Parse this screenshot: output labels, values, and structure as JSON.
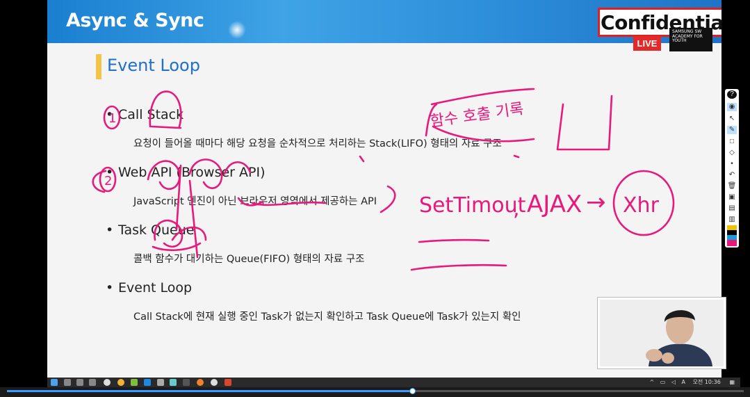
{
  "slide": {
    "header_title": "Async & Sync",
    "confidential": "Confidential",
    "live": "LIVE",
    "academy_logo": "SAMSUNG SW ACADEMY FOR YOUTH",
    "section_title": "Event Loop",
    "items": [
      {
        "bullet": "•",
        "title": "Call Stack",
        "desc": "요청이 들어올 때마다 해당 요청을 순차적으로 처리하는 Stack(LIFO) 형태의 자료 구조"
      },
      {
        "bullet": "•",
        "title": "Web API (Browser API)",
        "desc": "JavaScript 엔진이 아닌 브라우저 영역에서 제공하는 API"
      },
      {
        "bullet": "•",
        "title": "Task Queue",
        "desc": "콜백 함수가 대기하는 Queue(FIFO) 형태의 자료 구조"
      },
      {
        "bullet": "•",
        "title": "Event Loop",
        "desc": "Call Stack에 현재 실행 중인 Task가 없는지 확인하고 Task Queue에 Task가 있는지 확인"
      }
    ],
    "annotations": {
      "number_1": "1",
      "number_2": "2",
      "korean_note": "함수 호출 기록",
      "settimeout": "SetTimout",
      "comma": ",",
      "ajax": "AJAX",
      "arrow": "→",
      "xhr": "Xhr",
      "ink_color": "#e8197a"
    }
  },
  "toolbar": {
    "tools": [
      "help-icon",
      "eye-icon",
      "cursor-icon",
      "pen-icon",
      "shape-icon",
      "eraser-icon",
      "dot-icon",
      "undo-icon",
      "trash-icon",
      "camera-icon",
      "save-icon",
      "clipboard-icon"
    ],
    "colors": [
      "#f2c300",
      "#000000",
      "#1a9bd7",
      "#e8197a"
    ]
  },
  "taskbar": {
    "clock": "오전 10:36",
    "ime": "A",
    "tray_arrow": "^"
  },
  "video": {
    "progress": 0.55
  }
}
